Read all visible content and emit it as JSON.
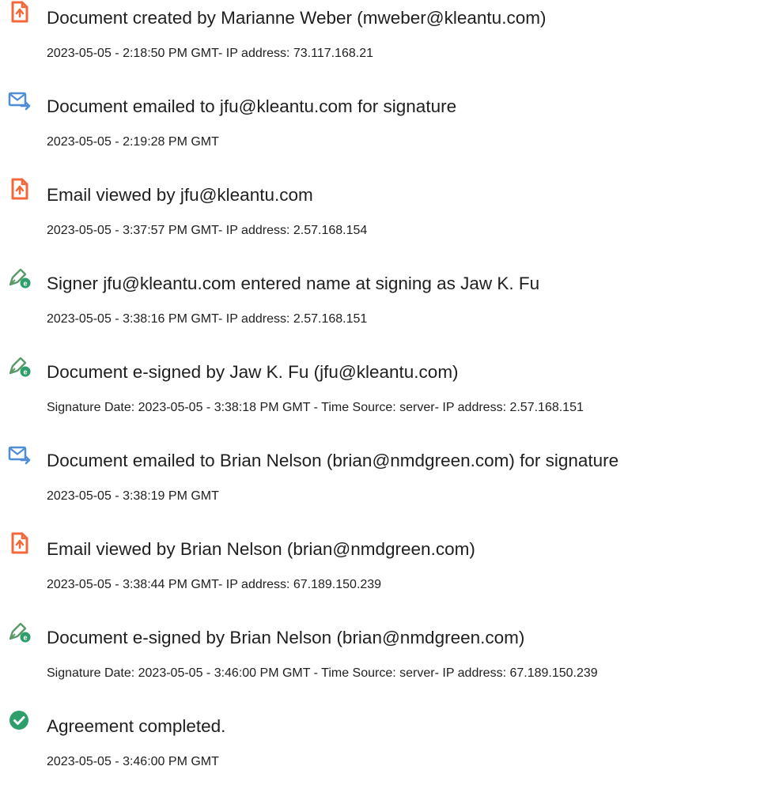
{
  "events": [
    {
      "icon": "document-icon",
      "title": "Document created by Marianne Weber (mweber@kleantu.com)",
      "detail": "2023-05-05 - 2:18:50 PM GMT- IP address: 73.117.168.21"
    },
    {
      "icon": "email-sent-icon",
      "title": "Document emailed to jfu@kleantu.com for signature",
      "detail": "2023-05-05 - 2:19:28 PM GMT"
    },
    {
      "icon": "document-icon",
      "title": "Email viewed by jfu@kleantu.com",
      "detail": "2023-05-05 - 3:37:57 PM GMT- IP address: 2.57.168.154"
    },
    {
      "icon": "e-sign-pen-icon",
      "title": "Signer jfu@kleantu.com entered name at signing as Jaw K. Fu",
      "detail": "2023-05-05 - 3:38:16 PM GMT- IP address: 2.57.168.151"
    },
    {
      "icon": "e-sign-pen-icon",
      "title": "Document e-signed by Jaw K. Fu (jfu@kleantu.com)",
      "detail": "Signature Date: 2023-05-05 - 3:38:18 PM GMT - Time Source: server- IP address: 2.57.168.151"
    },
    {
      "icon": "email-sent-icon",
      "title": "Document emailed to Brian Nelson (brian@nmdgreen.com) for signature",
      "detail": "2023-05-05 - 3:38:19 PM GMT"
    },
    {
      "icon": "document-icon",
      "title": "Email viewed by Brian Nelson (brian@nmdgreen.com)",
      "detail": "2023-05-05 - 3:38:44 PM GMT- IP address: 67.189.150.239"
    },
    {
      "icon": "e-sign-pen-icon",
      "title": "Document e-signed by Brian Nelson (brian@nmdgreen.com)",
      "detail": "Signature Date: 2023-05-05 - 3:46:00 PM GMT - Time Source: server- IP address: 67.189.150.239"
    },
    {
      "icon": "checkmark-circle-icon",
      "title": "Agreement completed.",
      "detail": "2023-05-05 - 3:46:00 PM GMT"
    }
  ],
  "colors": {
    "document_icon": "#f2683a",
    "email_icon": "#4f8dd6",
    "pen_icon": "#5a9a6a",
    "pen_badge": "#2e9e6b",
    "check_circle": "#2e9e6b"
  }
}
